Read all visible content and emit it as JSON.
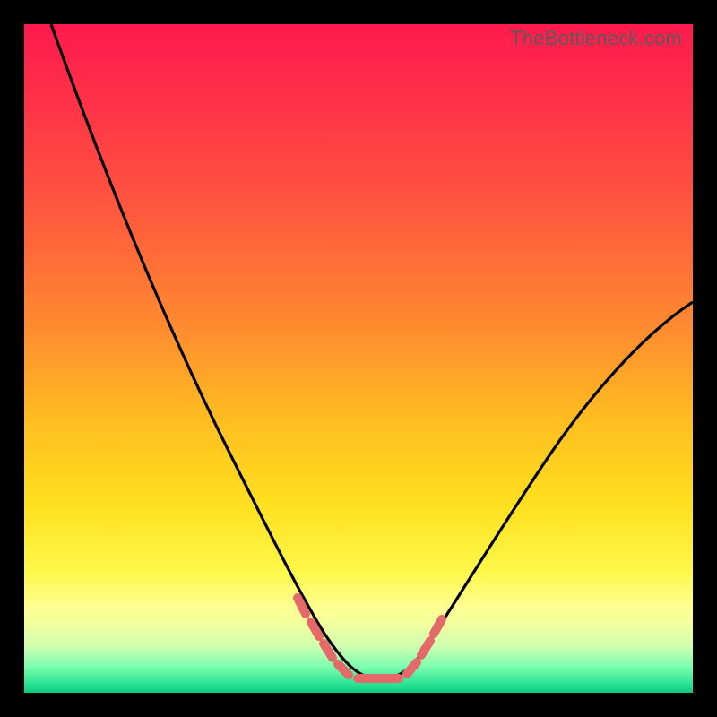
{
  "watermark": "TheBottleneck.com",
  "gradient_colors": {
    "top": "#ff1a4d",
    "mid_upper": "#ff8a30",
    "mid": "#ffe020",
    "lower": "#f0ffa0",
    "bottom": "#10c880"
  },
  "chart_data": {
    "type": "line",
    "title": "",
    "xlabel": "",
    "ylabel": "",
    "xlim": [
      0,
      100
    ],
    "ylim": [
      0,
      100
    ],
    "series": [
      {
        "name": "curve",
        "x": [
          4,
          10,
          15,
          20,
          25,
          30,
          35,
          40,
          43,
          46,
          48,
          50,
          52,
          54,
          56,
          58,
          62,
          68,
          75,
          82,
          90,
          100
        ],
        "y": [
          100,
          85,
          73,
          62,
          50,
          39,
          28,
          18,
          12,
          7,
          4,
          2.5,
          2,
          2,
          2.5,
          4,
          8,
          15,
          24,
          33,
          44,
          58
        ]
      }
    ],
    "annotations": {
      "dash_segments_left": [
        [
          41.5,
          13.5
        ],
        [
          43.3,
          10.2
        ],
        [
          45.4,
          6.9
        ],
        [
          47.8,
          3.8
        ]
      ],
      "dash_segments_right": [
        [
          57.5,
          3.8
        ],
        [
          59.6,
          6.8
        ],
        [
          61.1,
          9.8
        ]
      ],
      "flat_bottom": [
        [
          49.5,
          2.2
        ],
        [
          55.5,
          2.2
        ]
      ]
    }
  }
}
